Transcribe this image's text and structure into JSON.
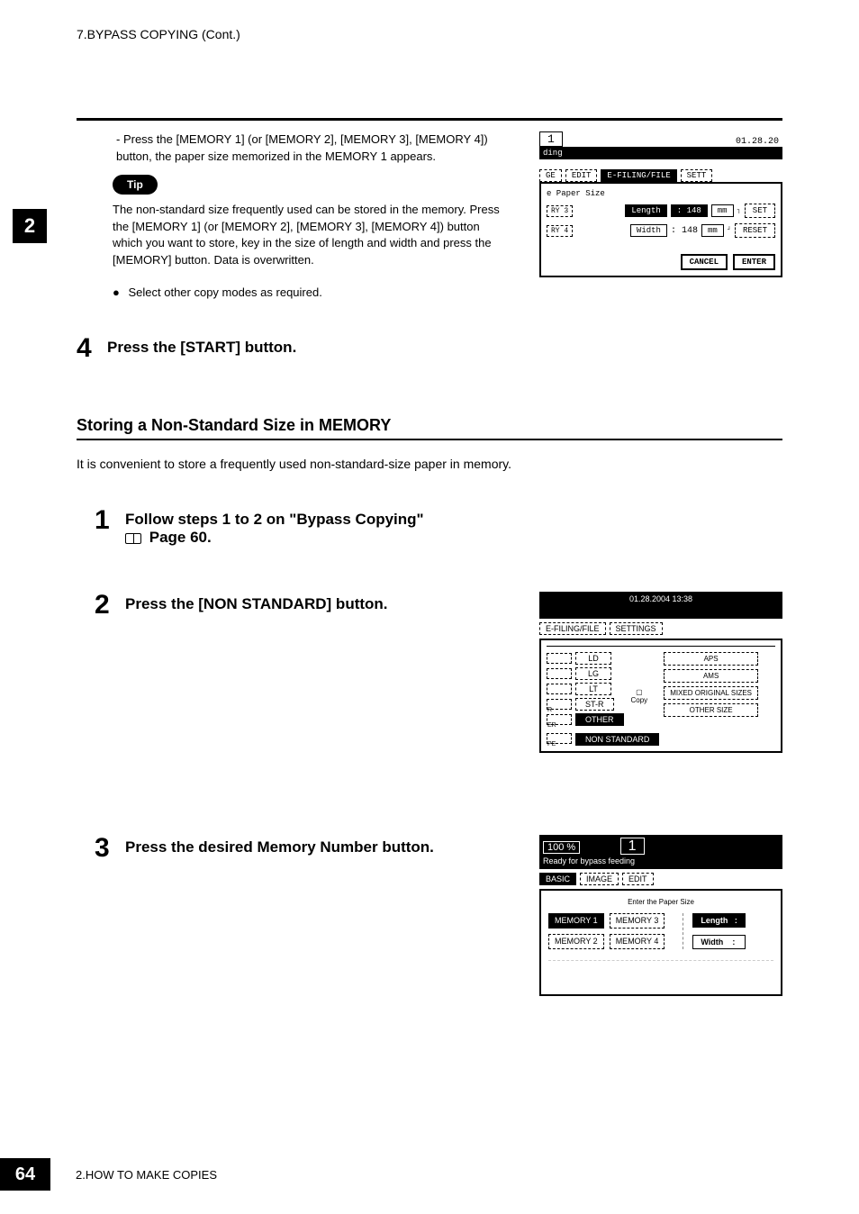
{
  "header": {
    "title": "7.BYPASS COPYING (Cont.)"
  },
  "chapter": {
    "number": "2"
  },
  "content": {
    "memory_text": "- Press the [MEMORY 1] (or [MEMORY 2], [MEMORY 3], [MEMORY 4]) button, the paper size memorized in the MEMORY 1 appears.",
    "tip_label": "Tip",
    "tip_text": "The non-standard size frequently used can be stored in the memory. Press the [MEMORY 1] (or [MEMORY 2], [MEMORY 3], [MEMORY 4]) button which you want to store, key in the size of length and width and press the [MEMORY] button. Data is overwritten.",
    "select_other": "Select other copy modes as required."
  },
  "step4": {
    "num": "4",
    "text": "Press the [START] button."
  },
  "section": {
    "heading": "Storing a Non-Standard Size in MEMORY",
    "intro": "It is convenient to store a frequently used non-standard-size paper in memory."
  },
  "step1": {
    "num": "1",
    "line1": "Follow steps 1 to 2 on \"Bypass Copying\"",
    "line2": "Page 60."
  },
  "step2": {
    "num": "2",
    "text": "Press the [NON STANDARD] button."
  },
  "step3": {
    "num": "3",
    "text": "Press the desired Memory Number button."
  },
  "ss1": {
    "num": "1",
    "ding": "ding",
    "date": "01.28.20",
    "tab_ge": "GE",
    "tab_edit": "EDIT",
    "tab_efiling": "E-FILING/FILE",
    "tab_sett": "SETT",
    "paper_size": "e Paper Size",
    "ry3": "RY 3",
    "ry4": "RY 4",
    "length_label": "Length",
    "length_val": "148",
    "width_label": "Width",
    "width_val": "148",
    "mm": "mm",
    "set": "SET",
    "reset": "RESET",
    "cancel": "CANCEL",
    "enter": "ENTER"
  },
  "ss2": {
    "date": "01.28.2004 13:38",
    "tab_efiling": "E-FILING/FILE",
    "tab_settings": "SETTINGS",
    "ld": "LD",
    "lg": "LG",
    "lt": "LT",
    "str": "ST-R",
    "other": "OTHER",
    "copy": "Copy",
    "aps": "APS",
    "ams": "AMS",
    "mixed": "MIXED ORIGINAL SIZES",
    "other_size": "OTHER SIZE",
    "r": "R",
    "er": "ER",
    "pe": "PE",
    "non_standard": "NON STANDARD"
  },
  "ss3": {
    "pct": "100",
    "pct_unit": "%",
    "num": "1",
    "ready": "Ready for bypass feeding",
    "tab_basic": "BASIC",
    "tab_image": "IMAGE",
    "tab_edit": "EDIT",
    "subtitle": "Enter the Paper Size",
    "mem1": "MEMORY 1",
    "mem2": "MEMORY 2",
    "mem3": "MEMORY 3",
    "mem4": "MEMORY 4",
    "length": "Length",
    "width": "Width",
    "colon": ":"
  },
  "footer": {
    "pagenum": "64",
    "text": "2.HOW TO MAKE COPIES"
  }
}
